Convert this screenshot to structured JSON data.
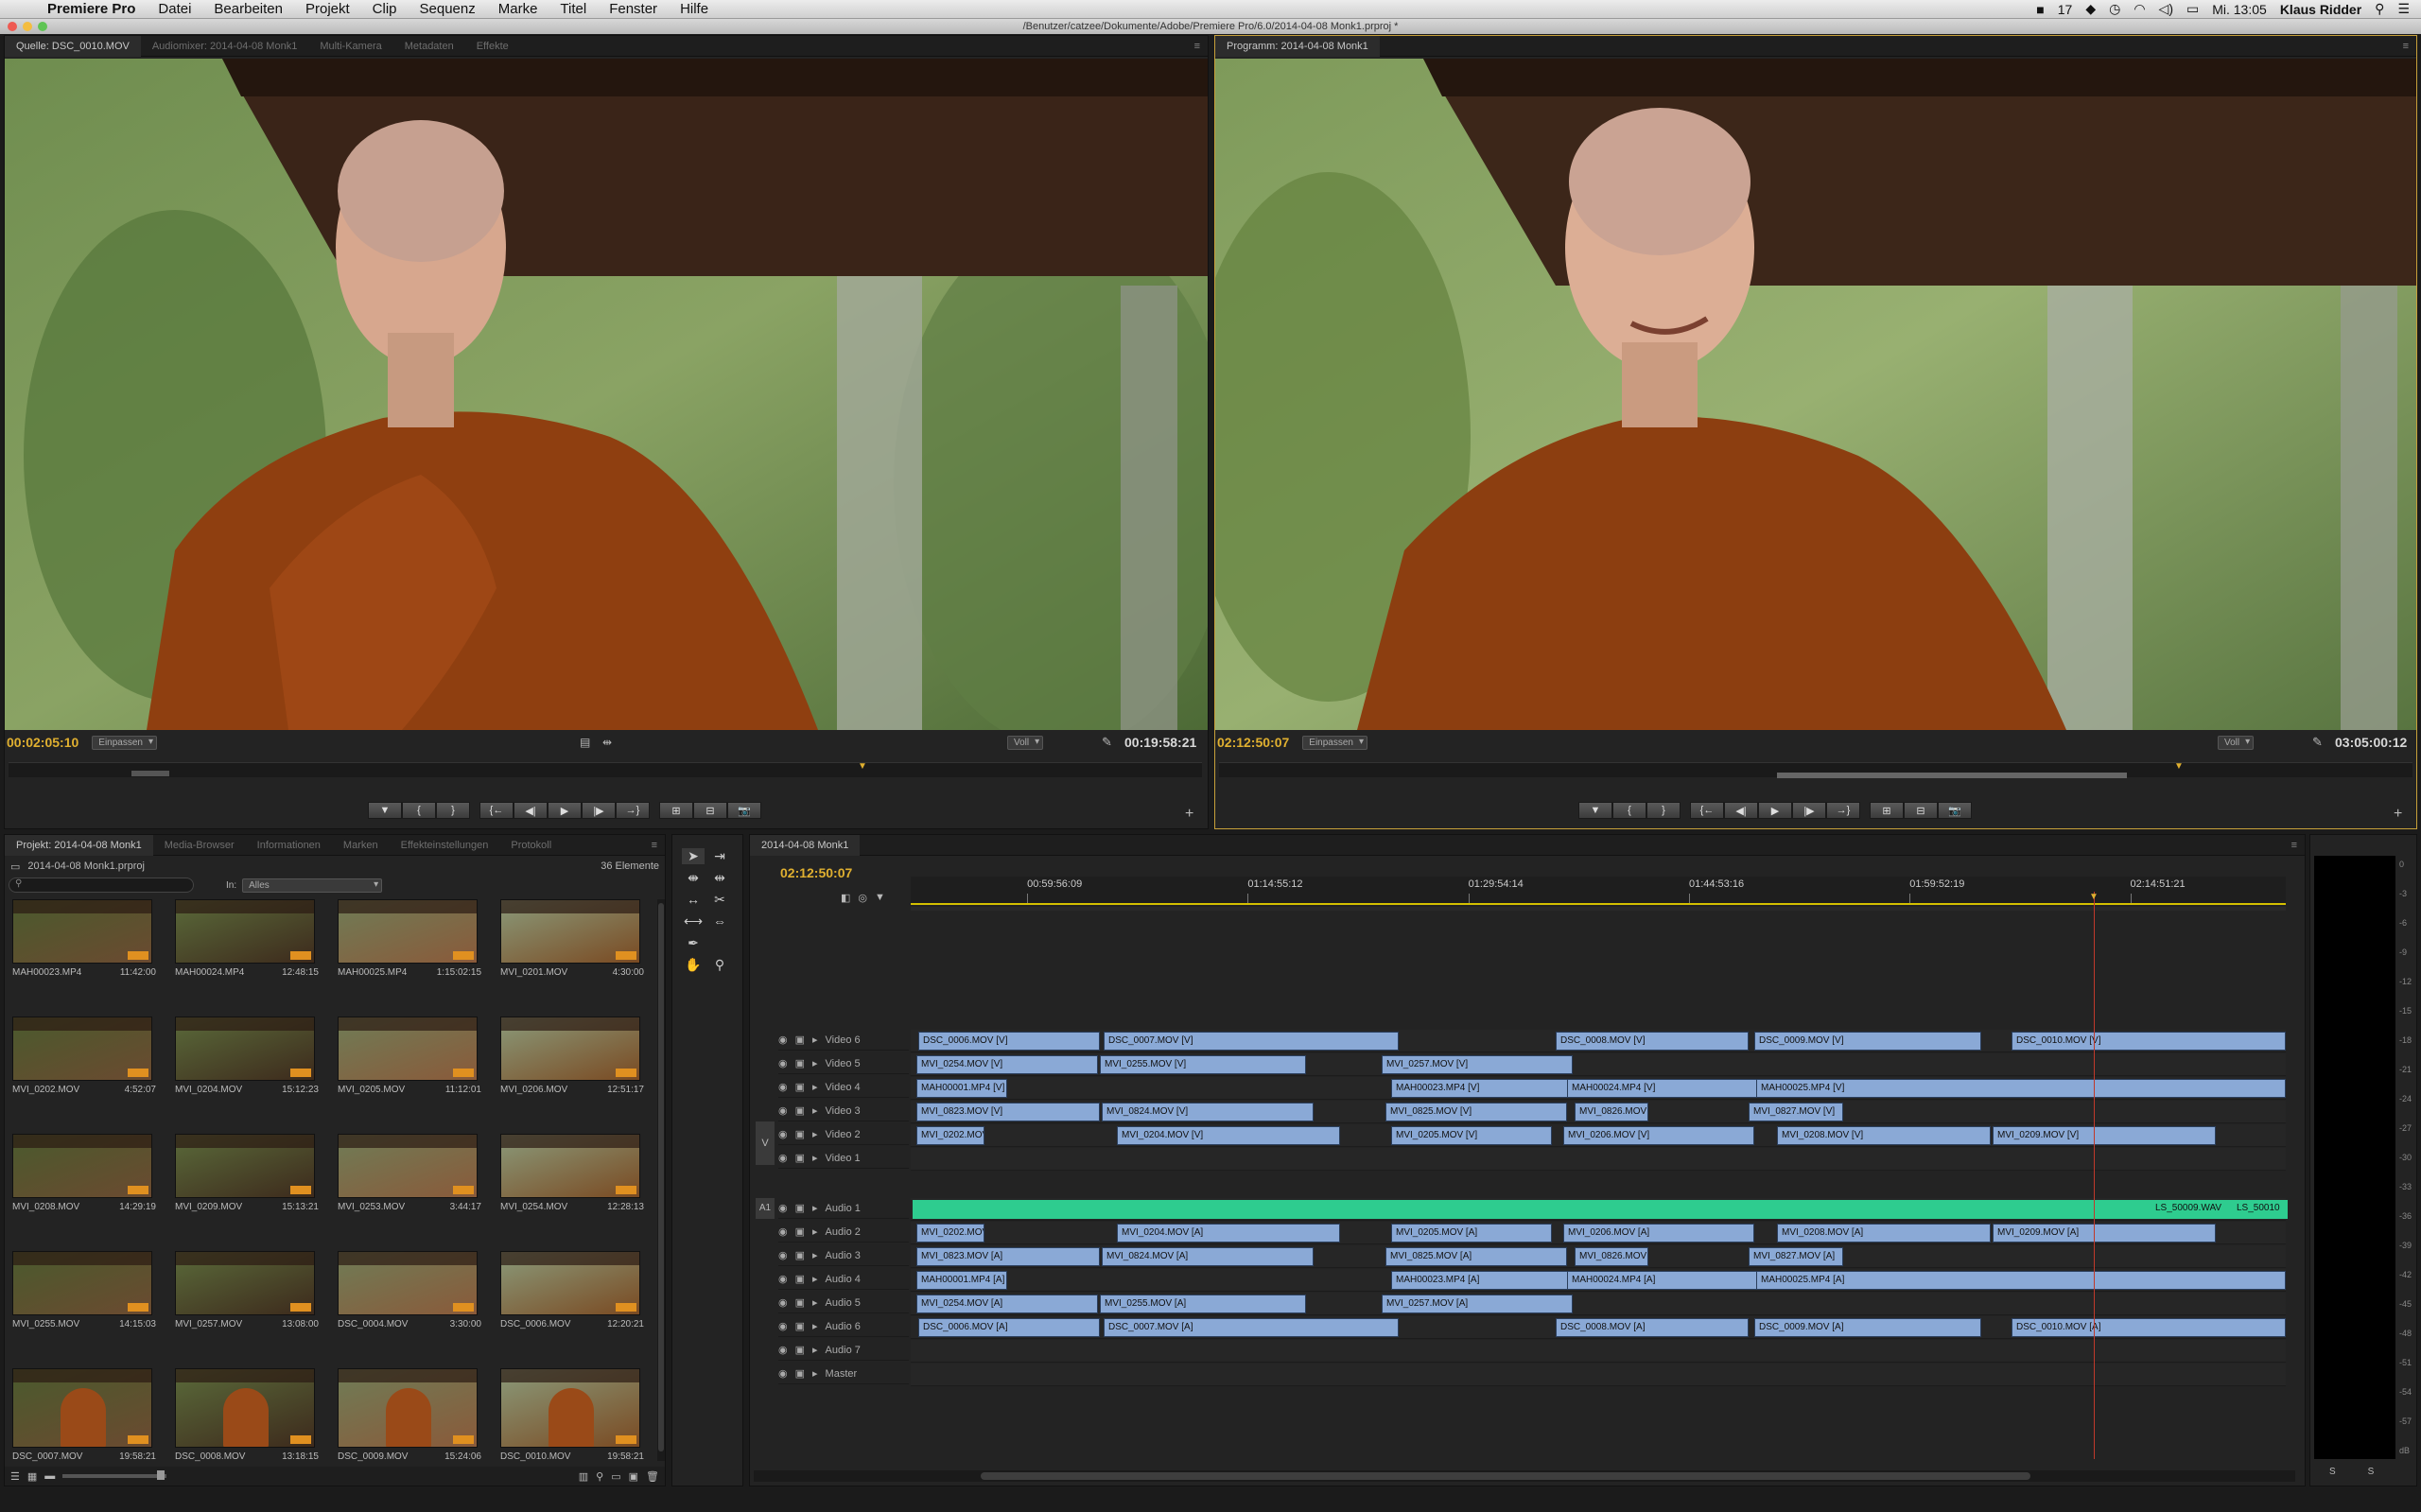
{
  "menubar": {
    "app": "Premiere Pro",
    "items": [
      "Datei",
      "Bearbeiten",
      "Projekt",
      "Clip",
      "Sequenz",
      "Marke",
      "Titel",
      "Fenster",
      "Hilfe"
    ],
    "status_num": "17",
    "clock": "Mi. 13:05",
    "user": "Klaus Ridder"
  },
  "window": {
    "title": "/Benutzer/catzee/Dokumente/Adobe/Premiere Pro/6.0/2014-04-08 Monk1.prproj *"
  },
  "source": {
    "tabs": [
      "Quelle: DSC_0010.MOV",
      "Audiomixer: 2014-04-08 Monk1",
      "Multi-Kamera",
      "Metadaten",
      "Effekte"
    ],
    "timecode": "00:02:05:10",
    "fit": "Einpassen",
    "quality": "Voll",
    "duration": "00:19:58:21"
  },
  "program": {
    "tabs": [
      "Programm: 2014-04-08 Monk1"
    ],
    "timecode": "02:12:50:07",
    "fit": "Einpassen",
    "quality": "Voll",
    "duration": "03:05:00:12"
  },
  "transport": [
    "▼",
    "{",
    "}",
    "{←",
    "◀|",
    "▶",
    "|▶",
    "→}",
    "⊞",
    "⊟",
    "📷"
  ],
  "project": {
    "tabs": [
      "Projekt: 2014-04-08 Monk1",
      "Media-Browser",
      "Informationen",
      "Marken",
      "Effekteinstellungen",
      "Protokoll"
    ],
    "filename": "2014-04-08 Monk1.prproj",
    "count": "36 Elemente",
    "in_label": "In:",
    "in_value": "Alles",
    "items": [
      {
        "name": "MAH00023.MP4",
        "dur": "11:42:00"
      },
      {
        "name": "MAH00024.MP4",
        "dur": "12:48:15"
      },
      {
        "name": "MAH00025.MP4",
        "dur": "1:15:02:15"
      },
      {
        "name": "MVI_0201.MOV",
        "dur": "4:30:00"
      },
      {
        "name": "MVI_0202.MOV",
        "dur": "4:52:07"
      },
      {
        "name": "MVI_0204.MOV",
        "dur": "15:12:23"
      },
      {
        "name": "MVI_0205.MOV",
        "dur": "11:12:01"
      },
      {
        "name": "MVI_0206.MOV",
        "dur": "12:51:17"
      },
      {
        "name": "MVI_0208.MOV",
        "dur": "14:29:19"
      },
      {
        "name": "MVI_0209.MOV",
        "dur": "15:13:21"
      },
      {
        "name": "MVI_0253.MOV",
        "dur": "3:44:17"
      },
      {
        "name": "MVI_0254.MOV",
        "dur": "12:28:13"
      },
      {
        "name": "MVI_0255.MOV",
        "dur": "14:15:03"
      },
      {
        "name": "MVI_0257.MOV",
        "dur": "13:08:00"
      },
      {
        "name": "DSC_0004.MOV",
        "dur": "3:30:00"
      },
      {
        "name": "DSC_0006.MOV",
        "dur": "12:20:21"
      },
      {
        "name": "DSC_0007.MOV",
        "dur": "19:58:21"
      },
      {
        "name": "DSC_0008.MOV",
        "dur": "13:18:15"
      },
      {
        "name": "DSC_0009.MOV",
        "dur": "15:24:06"
      },
      {
        "name": "DSC_0010.MOV",
        "dur": "19:58:21"
      }
    ]
  },
  "timeline": {
    "tab": "2014-04-08 Monk1",
    "timecode": "02:12:50:07",
    "ruler": [
      "00:59:56:09",
      "01:14:55:12",
      "01:29:54:14",
      "01:44:53:16",
      "01:59:52:19",
      "02:14:51:21"
    ],
    "video_tracks": [
      "Video 6",
      "Video 5",
      "Video 4",
      "Video 3",
      "Video 2",
      "Video 1"
    ],
    "audio_tracks": [
      "Audio 1",
      "Audio 2",
      "Audio 3",
      "Audio 4",
      "Audio 5",
      "Audio 6",
      "Audio 7",
      "Master"
    ],
    "v_label": "V",
    "a1_label": "A1",
    "v6": [
      "DSC_0006.MOV [V]",
      "DSC_0007.MOV [V]",
      "DSC_0008.MOV [V]",
      "DSC_0009.MOV [V]",
      "DSC_0010.MOV [V]"
    ],
    "v5": [
      "MVI_0254.MOV [V]",
      "MVI_0255.MOV [V]",
      "MVI_0257.MOV [V]"
    ],
    "v4": [
      "MAH00001.MP4 [V]",
      "MAH00023.MP4 [V]",
      "MAH00024.MP4 [V]",
      "MAH00025.MP4 [V]"
    ],
    "v3": [
      "MVI_0823.MOV [V]",
      "MVI_0824.MOV [V]",
      "MVI_0825.MOV [V]",
      "MVI_0826.MOV",
      "MVI_0827.MOV [V]"
    ],
    "v2": [
      "MVI_0202.MOV",
      "MVI_0204.MOV [V]",
      "MVI_0205.MOV [V]",
      "MVI_0206.MOV [V]",
      "MVI_0208.MOV [V]",
      "MVI_0209.MOV [V]"
    ],
    "a1": [
      "LS_50009.WAV",
      "LS_50010"
    ],
    "a2": [
      "MVI_0202.MOV",
      "MVI_0204.MOV [A]",
      "MVI_0205.MOV [A]",
      "MVI_0206.MOV [A]",
      "MVI_0208.MOV [A]",
      "MVI_0209.MOV [A]"
    ],
    "a3": [
      "MVI_0823.MOV [A]",
      "MVI_0824.MOV [A]",
      "MVI_0825.MOV [A]",
      "MVI_0826.MOV",
      "MVI_0827.MOV [A]"
    ],
    "a4": [
      "MAH00001.MP4 [A]",
      "MAH00023.MP4 [A]",
      "MAH00024.MP4 [A]",
      "MAH00025.MP4 [A]"
    ],
    "a5": [
      "MVI_0254.MOV [A]",
      "MVI_0255.MOV [A]",
      "MVI_0257.MOV [A]"
    ],
    "a6": [
      "DSC_0006.MOV [A]",
      "DSC_0007.MOV [A]",
      "DSC_0008.MOV [A]",
      "DSC_0009.MOV [A]",
      "DSC_0010.MOV [A]"
    ]
  },
  "meter": {
    "scale": [
      "0",
      "-3",
      "-6",
      "-9",
      "-12",
      "-15",
      "-18",
      "-21",
      "-24",
      "-27",
      "-30",
      "-33",
      "-36",
      "-39",
      "-42",
      "-45",
      "-48",
      "-51",
      "-54",
      "-57",
      "dB"
    ]
  },
  "colors": {
    "accent": "#e0b030",
    "clip": "#8aa9d6",
    "audio1": "#2ecc8f",
    "playhead": "#c0392b"
  }
}
